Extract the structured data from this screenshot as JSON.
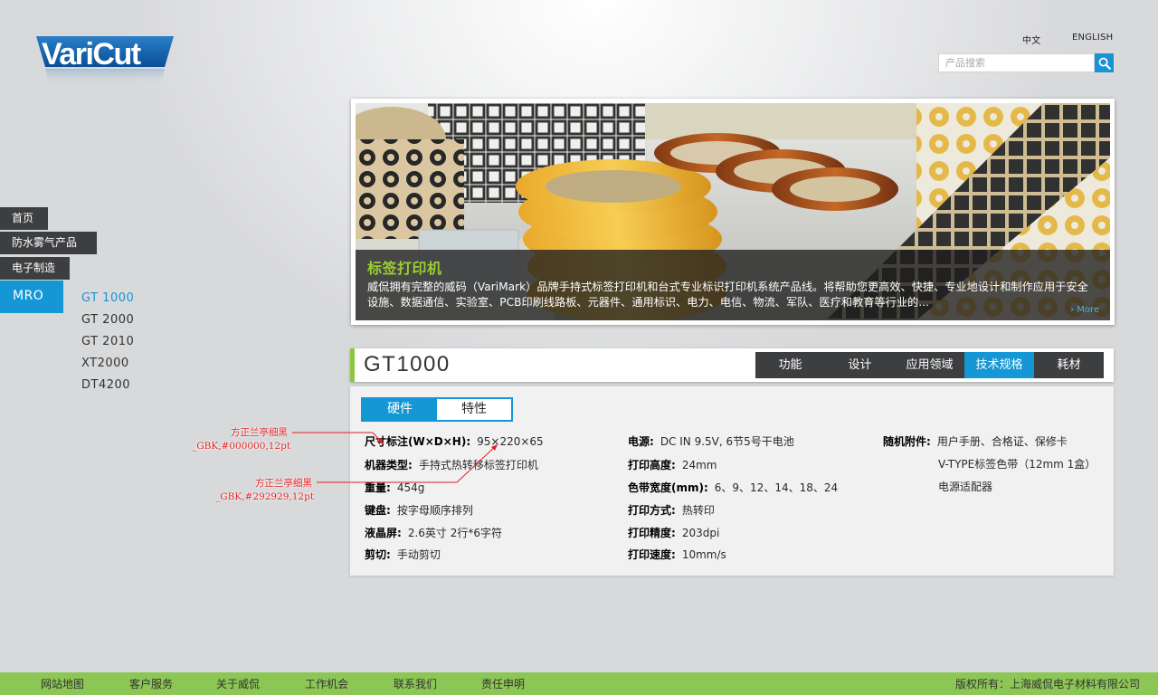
{
  "logo": {
    "text": "VariCut"
  },
  "header": {
    "lang_zh": "中文",
    "lang_en": "ENGLISH",
    "search_placeholder": "产品搜索"
  },
  "nav": {
    "items": [
      {
        "label": "首页"
      },
      {
        "label": "防水雾气产品"
      },
      {
        "label": "电子制造"
      },
      {
        "label": "MRO",
        "active": true
      }
    ],
    "sub_items": [
      {
        "label": "GT 1000",
        "active": true
      },
      {
        "label": "GT 2000"
      },
      {
        "label": "GT 2010"
      },
      {
        "label": "XT2000"
      },
      {
        "label": "DT4200"
      }
    ]
  },
  "banner": {
    "title": "标签打印机",
    "description": "威侃拥有完整的威码（VariMark）品牌手持式标签打印机和台式专业标识打印机系统产品线。将帮助您更高效、快捷、专业地设计和制作应用于安全设施、数据通信、实验室、PCB印刷线路板、元器件、通用标识、电力、电信、物流、军队、医疗和教育等行业的...",
    "more": "› More"
  },
  "product": {
    "title": "GT1000",
    "tabs": [
      {
        "label": "功能"
      },
      {
        "label": "设计"
      },
      {
        "label": "应用领域"
      },
      {
        "label": "技术规格",
        "active": true
      },
      {
        "label": "耗材"
      }
    ]
  },
  "spec": {
    "subtabs": [
      {
        "label": "硬件",
        "active": true
      },
      {
        "label": "特性"
      }
    ],
    "col1": [
      {
        "key": "尺寸标注(W×D×H):",
        "value": "95×220×65"
      },
      {
        "key": "机器类型:",
        "value": "手持式热转移标签打印机"
      },
      {
        "key": "重量:",
        "value": "454g"
      },
      {
        "key": "键盘:",
        "value": "按字母顺序排列"
      },
      {
        "key": "液晶屏:",
        "value": "2.6英寸 2行*6字符"
      },
      {
        "key": "剪切:",
        "value": "手动剪切"
      }
    ],
    "col2": [
      {
        "key": "电源:",
        "value": "DC IN 9.5V, 6节5号干电池"
      },
      {
        "key": "打印高度:",
        "value": "24mm"
      },
      {
        "key": "色带宽度(mm):",
        "value": "6、9、12、14、18、24"
      },
      {
        "key": "打印方式:",
        "value": "热转印"
      },
      {
        "key": "打印精度:",
        "value": "203dpi"
      },
      {
        "key": "打印速度:",
        "value": "10mm/s"
      }
    ],
    "col3": {
      "key": "随机附件:",
      "values": [
        "用户手册、合格证、保修卡",
        "V-TYPE标签色带（12mm 1盒）",
        "电源适配器"
      ]
    }
  },
  "annotations": [
    {
      "line1": "方正兰亭细黑",
      "line2": "_GBK,#000000,12pt"
    },
    {
      "line1": "方正兰亭细黑",
      "line2": "_GBK,#292929,12pt"
    }
  ],
  "footer": {
    "links": [
      {
        "label": "网站地图"
      },
      {
        "label": "客户服务"
      },
      {
        "label": "关于威侃"
      },
      {
        "label": "工作机会"
      },
      {
        "label": "联系我们"
      },
      {
        "label": "责任申明"
      }
    ],
    "copyright": "版权所有：上海威侃电子材料有限公司"
  },
  "colors": {
    "accent_blue": "#1497d4",
    "accent_green": "#8cc63f",
    "footer_green": "#8cc654",
    "nav_dark": "#3d3e40",
    "annotation_red": "#e02020"
  },
  "icons": {
    "search": "magnifier-icon"
  }
}
